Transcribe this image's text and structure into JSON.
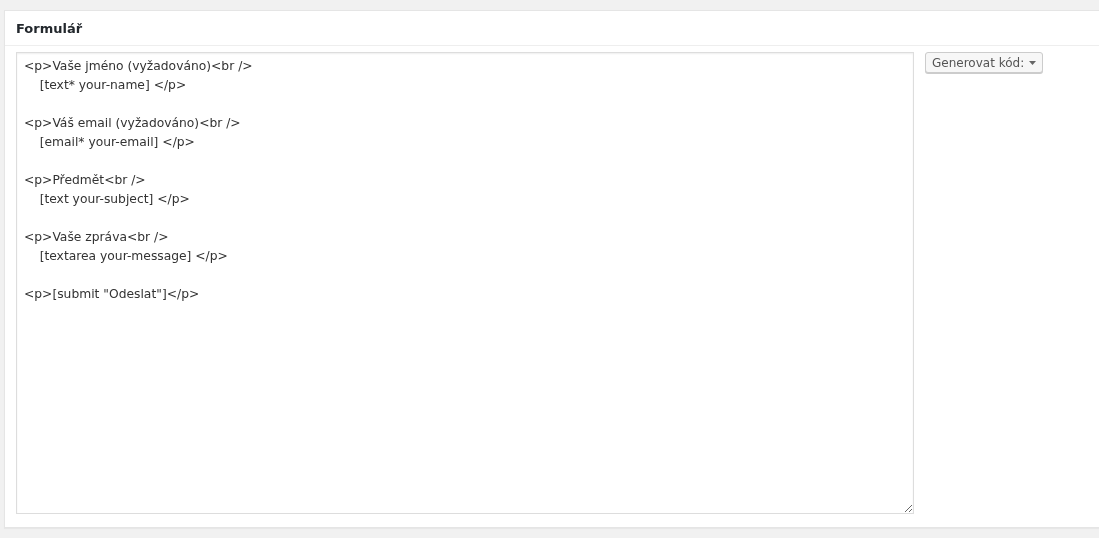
{
  "panel": {
    "title": "Formulář"
  },
  "editor": {
    "value": "<p>Vaše jméno (vyžadováno)<br />\n    [text* your-name] </p>\n\n<p>Váš email (vyžadováno)<br />\n    [email* your-email] </p>\n\n<p>Předmět<br />\n    [text your-subject] </p>\n\n<p>Vaše zpráva<br />\n    [textarea your-message] </p>\n\n<p>[submit \"Odeslat\"]</p>"
  },
  "generate_button": {
    "label": "Generovat kód:"
  }
}
